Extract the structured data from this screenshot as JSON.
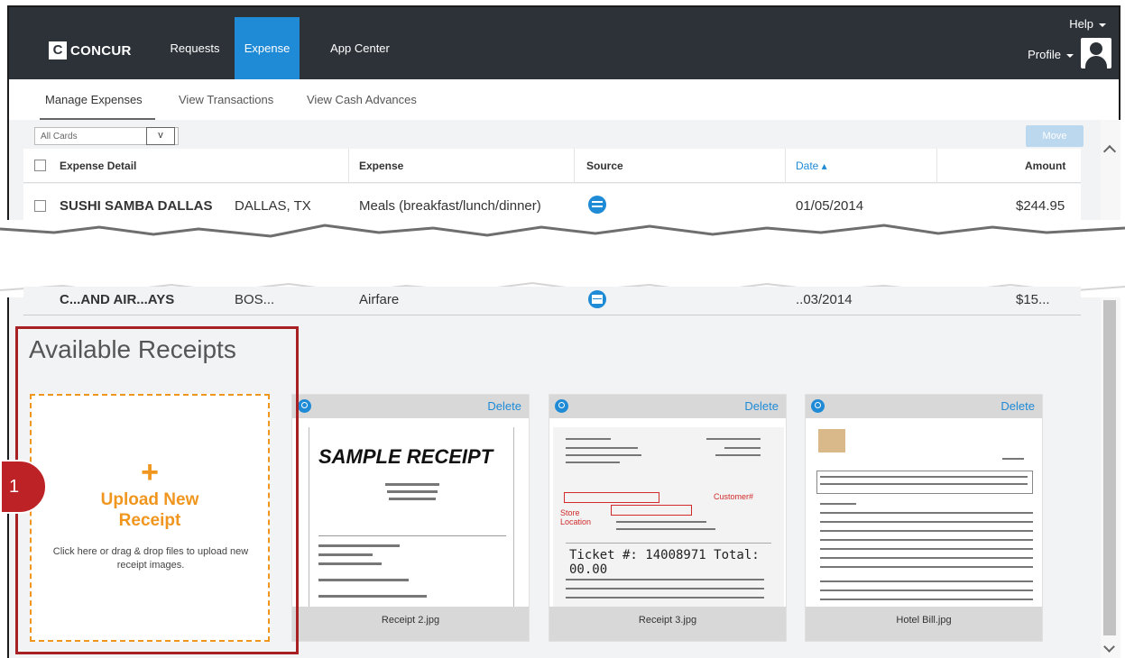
{
  "app": {
    "logo_mark": "C",
    "logo_text": "CONCUR",
    "nav": [
      "Requests",
      "Expense",
      "App Center"
    ],
    "help_label": "Help",
    "profile_label": "Profile"
  },
  "subnav": {
    "items": [
      "Manage Expenses",
      "View Transactions",
      "View Cash Advances"
    ]
  },
  "filter": {
    "value": "All Cards",
    "chevron": "v",
    "new_button": "Move"
  },
  "table": {
    "headers": [
      "Expense Detail",
      "Expense",
      "Source",
      "Date ▴",
      "Amount"
    ],
    "rows": [
      {
        "merchant": "SUSHI SAMBA DALLAS",
        "location": "DALLAS, TX",
        "expense": "Meals (breakfast/lunch/dinner)",
        "source_icon": "card-icon",
        "date": "01/05/2014",
        "amount": "$244.95"
      },
      {
        "merchant": "C...AND AIR...AYS",
        "location": "BOS...",
        "expense": "Airfare",
        "source_icon": "calendar-icon",
        "date": "..03/2014",
        "amount": "$15..."
      }
    ]
  },
  "receipts": {
    "section_title": "Available Receipts",
    "upload": {
      "plus": "+",
      "title_line1": "Upload New",
      "title_line2": "Receipt",
      "description": "Click here or drag & drop files to upload new receipt images."
    },
    "delete_label": "Delete",
    "items": [
      {
        "filename": "Receipt 2.jpg",
        "heading": "SAMPLE RECEIPT"
      },
      {
        "filename": "Receipt 3.jpg",
        "ticket": "Ticket #: 14008971   Total: 00.00",
        "annotations": [
          "Customer#",
          "Store Location"
        ]
      },
      {
        "filename": "Hotel Bill.jpg"
      }
    ]
  },
  "badge": {
    "number": "1"
  },
  "colors": {
    "nav_bg": "#2d3239",
    "accent": "#1f8ad6",
    "upload_orange": "#f0961e",
    "highlight_red": "#a62024"
  }
}
